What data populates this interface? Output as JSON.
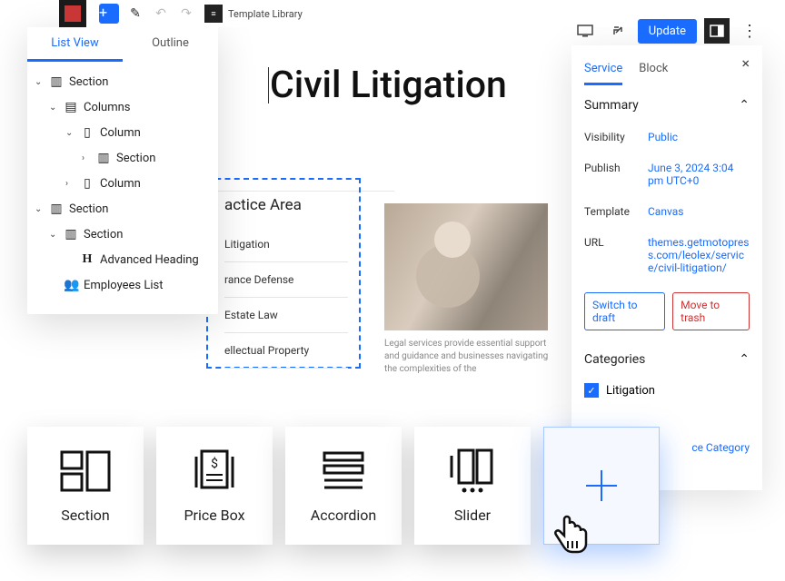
{
  "topbar": {
    "template_library": "Template Library"
  },
  "actions": {
    "update": "Update"
  },
  "list_panel": {
    "tabs": {
      "list_view": "List View",
      "outline": "Outline"
    },
    "items": [
      {
        "label": "Section"
      },
      {
        "label": "Columns"
      },
      {
        "label": "Column"
      },
      {
        "label": "Section"
      },
      {
        "label": "Column"
      },
      {
        "label": "Section"
      },
      {
        "label": "Section"
      },
      {
        "label": "Advanced Heading"
      },
      {
        "label": "Employees List"
      }
    ]
  },
  "canvas": {
    "title": "Civil Litigation",
    "box_head": "actice Area",
    "box_items": [
      "Litigation",
      "rance Defense",
      "Estate Law",
      "ellectual Property"
    ],
    "caption": "Legal services provide essential support and guidance and businesses navigating the complexities of the"
  },
  "sidebar": {
    "tabs": {
      "service": "Service",
      "block": "Block"
    },
    "summary": "Summary",
    "visibility": {
      "lbl": "Visibility",
      "val": "Public"
    },
    "publish": {
      "lbl": "Publish",
      "val": "June 3, 2024 3:04 pm UTC+0"
    },
    "template": {
      "lbl": "Template",
      "val": "Canvas"
    },
    "url": {
      "lbl": "URL",
      "val": "themes.getmotopress.com/leolex/service/civil-litigation/"
    },
    "switch_draft": "Switch to draft",
    "move_trash": "Move to trash",
    "categories": "Categories",
    "cat1": "Litigation",
    "add_cat": "ce Category"
  },
  "blocks": {
    "section": "Section",
    "pricebox": "Price Box",
    "accordion": "Accordion",
    "slider": "Slider"
  }
}
